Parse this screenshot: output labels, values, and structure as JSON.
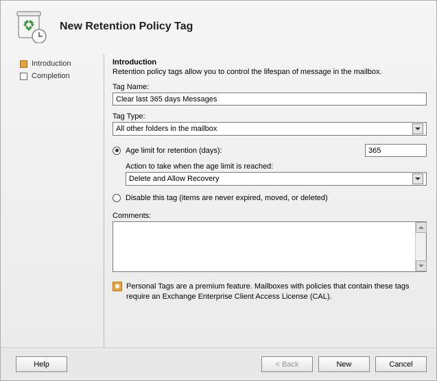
{
  "header": {
    "title": "New Retention Policy Tag"
  },
  "steps": {
    "introduction": "Introduction",
    "completion": "Completion"
  },
  "content": {
    "section_title": "Introduction",
    "section_desc": "Retention policy tags allow you to control the lifespan of message in the mailbox.",
    "tag_name_label": "Tag Name:",
    "tag_name_value": "Clear last 365 days Messages",
    "tag_type_label": "Tag Type:",
    "tag_type_value": "All other folders in the mailbox",
    "age_limit_label": "Age limit for retention (days):",
    "age_limit_value": "365",
    "action_label": "Action to take when the age limit is reached:",
    "action_value": "Delete and Allow Recovery",
    "disable_label": "Disable this tag (items are never expired, moved, or deleted)",
    "comments_label": "Comments:",
    "notice_text": "Personal Tags are a premium feature. Mailboxes with policies that contain these tags require an Exchange Enterprise Client Access License (CAL)."
  },
  "footer": {
    "help": "Help",
    "back": "< Back",
    "new": "New",
    "cancel": "Cancel"
  }
}
